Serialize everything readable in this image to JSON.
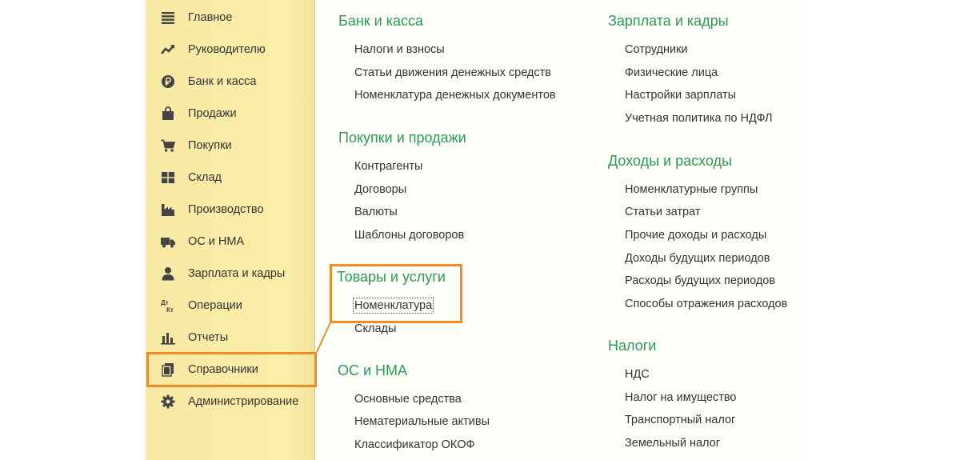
{
  "sidebar": {
    "items": [
      {
        "label": "Главное",
        "icon": "menu-lines-icon"
      },
      {
        "label": "Руководителю",
        "icon": "trend-icon"
      },
      {
        "label": "Банк и касса",
        "icon": "ruble-icon"
      },
      {
        "label": "Продажи",
        "icon": "bag-icon"
      },
      {
        "label": "Покупки",
        "icon": "cart-icon"
      },
      {
        "label": "Склад",
        "icon": "warehouse-grid-icon"
      },
      {
        "label": "Производство",
        "icon": "factory-icon"
      },
      {
        "label": "ОС и НМА",
        "icon": "truck-icon"
      },
      {
        "label": "Зарплата и кадры",
        "icon": "person-icon"
      },
      {
        "label": "Операции",
        "icon": "dt-kt-icon"
      },
      {
        "label": "Отчеты",
        "icon": "bar-chart-icon"
      },
      {
        "label": "Справочники",
        "icon": "books-icon"
      },
      {
        "label": "Администрирование",
        "icon": "gear-icon"
      }
    ],
    "active": "Справочники"
  },
  "columns": [
    {
      "sections": [
        {
          "title": "Банк и касса",
          "links": [
            "Налоги и взносы",
            "Статьи движения денежных средств",
            "Номенклатура денежных документов"
          ]
        },
        {
          "title": "Покупки и продажи",
          "links": [
            "Контрагенты",
            "Договоры",
            "Валюты",
            "Шаблоны договоров"
          ]
        },
        {
          "title": "Товары и услуги",
          "links": [
            "Номенклатура",
            "Склады"
          ]
        },
        {
          "title": "ОС и НМА",
          "links": [
            "Основные средства",
            "Нематериальные активы",
            "Классификатор ОКОФ"
          ]
        }
      ]
    },
    {
      "sections": [
        {
          "title": "Зарплата и кадры",
          "links": [
            "Сотрудники",
            "Физические лица",
            "Настройки зарплаты",
            "Учетная политика по НДФЛ"
          ]
        },
        {
          "title": "Доходы и расходы",
          "links": [
            "Номенклатурные группы",
            "Статьи затрат",
            "Прочие доходы и расходы",
            "Доходы будущих периодов",
            "Расходы будущих периодов",
            "Способы отражения расходов"
          ]
        },
        {
          "title": "Налоги",
          "links": [
            "НДС",
            "Налог на имущество",
            "Транспортный налог",
            "Земельный налог"
          ]
        }
      ]
    }
  ],
  "colors": {
    "sidebar_bg": "#fbeea9",
    "section_title": "#2e9a56",
    "highlight": "#f08a26",
    "text": "#333333"
  }
}
